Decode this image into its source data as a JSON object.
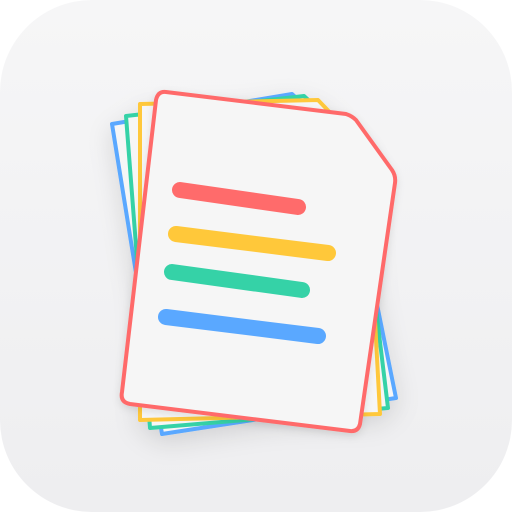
{
  "icon": {
    "name": "documents-stack-icon",
    "background_color": "#f2f2f4",
    "paper_color": "#f6f6f6",
    "sheets": [
      {
        "role": "back-sheet",
        "border_color": "#5aa8ff"
      },
      {
        "role": "third-sheet",
        "border_color": "#35d2a7"
      },
      {
        "role": "second-sheet",
        "border_color": "#ffc83a"
      },
      {
        "role": "front-sheet",
        "border_color": "#ff6b6b"
      }
    ],
    "lines": [
      {
        "role": "text-line-1",
        "color": "#ff6b6b"
      },
      {
        "role": "text-line-2",
        "color": "#ffc83a"
      },
      {
        "role": "text-line-3",
        "color": "#35d2a7"
      },
      {
        "role": "text-line-4",
        "color": "#5aa8ff"
      }
    ]
  }
}
